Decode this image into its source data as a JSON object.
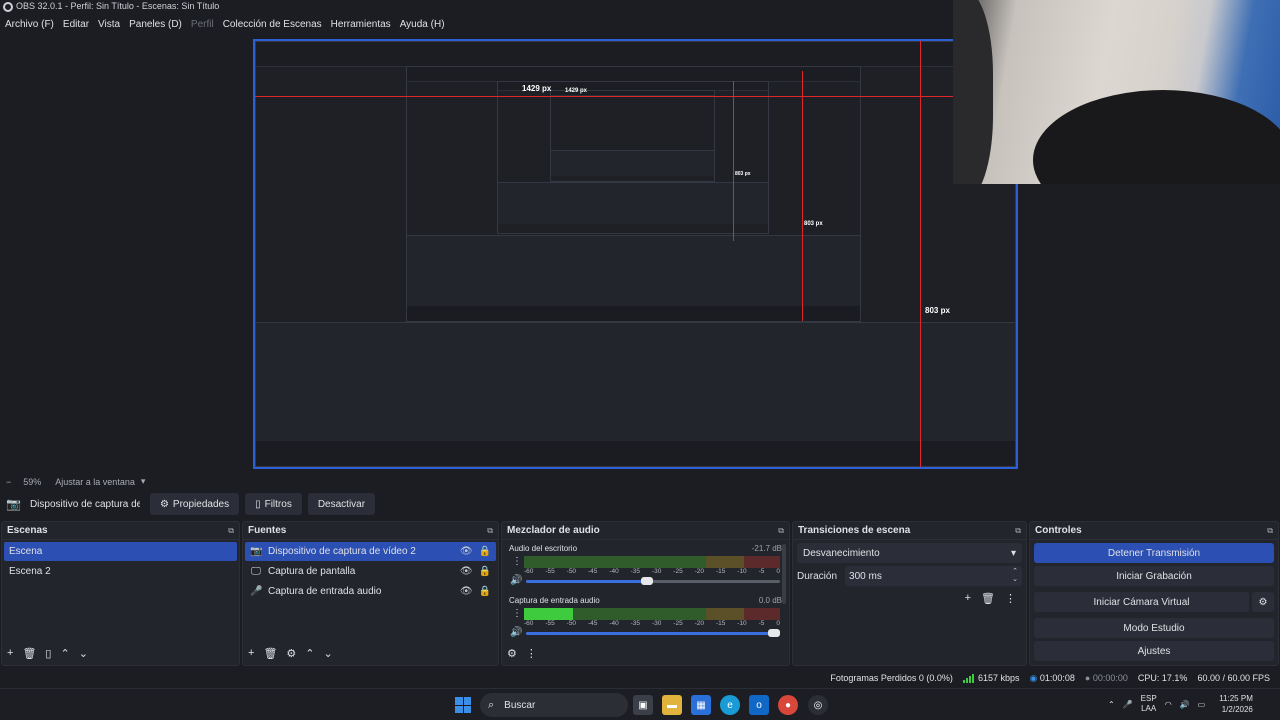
{
  "window": {
    "title": "OBS 32.0.1 - Perfil: Sin Título - Escenas: Sin Título"
  },
  "menu": [
    "Archivo (F)",
    "Editar",
    "Vista",
    "Paneles (D)",
    "Perfil",
    "Colección de Escenas",
    "Herramientas",
    "Ayuda (H)"
  ],
  "menu_disabled_index": 4,
  "preview": {
    "measure_width": "1429 px",
    "measure_width_inner": "1429 px",
    "measure_height": "803 px",
    "measure_height_inner": "803 px",
    "measure_height_small": "803 px"
  },
  "zoom": {
    "minus": "−",
    "level": "59%",
    "fit": "Ajustar a la ventana"
  },
  "source_toolbar": {
    "source_name": "Dispositivo de captura de v",
    "properties": "Propiedades",
    "filters": "Filtros",
    "deactivate": "Desactivar"
  },
  "scenes": {
    "title": "Escenas",
    "items": [
      "Escena",
      "Escena 2"
    ],
    "selected": 0
  },
  "sources": {
    "title": "Fuentes",
    "items": [
      {
        "label": "Dispositivo de captura de vídeo 2",
        "icon": "camera-icon"
      },
      {
        "label": "Captura de pantalla",
        "icon": "monitor-icon"
      },
      {
        "label": "Captura de entrada audio",
        "icon": "microphone-icon"
      }
    ],
    "selected": 0
  },
  "mixer": {
    "title": "Mezclador de audio",
    "channels": [
      {
        "name": "Audio del escritorio",
        "db": "-21.7 dB",
        "level": 0.0,
        "volume": 0.5
      },
      {
        "name": "Captura de entrada audio",
        "db": "0.0 dB",
        "level": 0.19,
        "volume": 1.0
      }
    ],
    "ticks": [
      "-60",
      "-55",
      "-50",
      "-45",
      "-40",
      "-35",
      "-30",
      "-25",
      "-20",
      "-15",
      "-10",
      "-5",
      "0"
    ]
  },
  "transitions": {
    "title": "Transiciones de escena",
    "selected": "Desvanecimiento",
    "duration_label": "Duración",
    "duration_value": "300 ms"
  },
  "controls": {
    "title": "Controles",
    "stop_stream": "Detener Transmisión",
    "start_recording": "Iniciar Grabación",
    "start_virtual_cam": "Iniciar Cámara Virtual",
    "studio_mode": "Modo Estudio",
    "settings": "Ajustes"
  },
  "status": {
    "dropped_frames": "Fotogramas Perdidos 0 (0.0%)",
    "bitrate": "6157 kbps",
    "stream_time": "01:00:08",
    "record_time": "00:00:00",
    "cpu": "CPU: 17.1%",
    "fps": "60.00 / 60.00 FPS"
  },
  "taskbar": {
    "search": "Buscar",
    "lang_top": "ESP",
    "lang_bottom": "LAA",
    "time": "11:25 PM",
    "date": "1/2/2026"
  },
  "colors": {
    "accent": "#2c4fb3",
    "selection_border": "#2a5fd6",
    "measure_line": "#e1262b",
    "meter_green": "#3ecb3e"
  }
}
